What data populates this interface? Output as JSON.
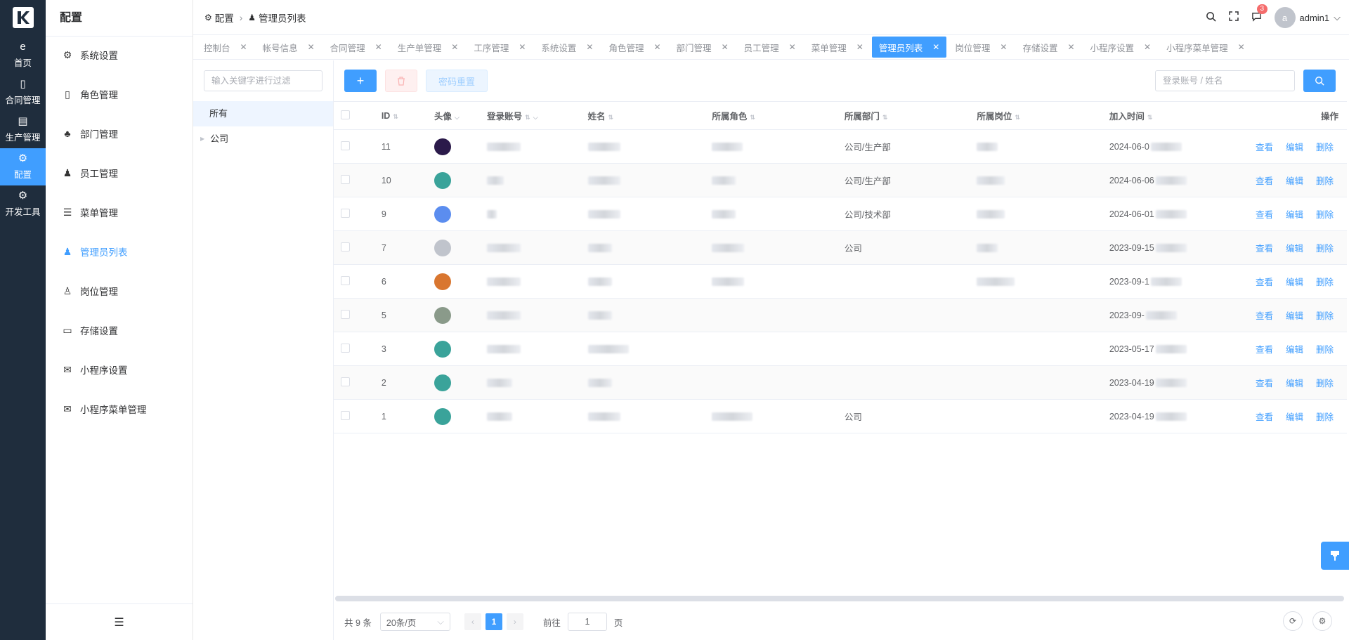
{
  "rail": {
    "items": [
      {
        "label": "首页",
        "icon": "e"
      },
      {
        "label": "合同管理",
        "icon": "▯"
      },
      {
        "label": "生产管理",
        "icon": "▤"
      },
      {
        "label": "配置",
        "icon": "⚙"
      },
      {
        "label": "开发工具",
        "icon": "⚙"
      }
    ]
  },
  "submenu": {
    "title": "配置",
    "items": [
      {
        "label": "系统设置",
        "icon": "⚙"
      },
      {
        "label": "角色管理",
        "icon": "▯"
      },
      {
        "label": "部门管理",
        "icon": "♣"
      },
      {
        "label": "员工管理",
        "icon": "♟"
      },
      {
        "label": "菜单管理",
        "icon": "☰"
      },
      {
        "label": "管理员列表",
        "icon": "♟"
      },
      {
        "label": "岗位管理",
        "icon": "♙"
      },
      {
        "label": "存储设置",
        "icon": "▭"
      },
      {
        "label": "小程序设置",
        "icon": "✉"
      },
      {
        "label": "小程序菜单管理",
        "icon": "✉"
      }
    ],
    "collapse_icon": "☰"
  },
  "header": {
    "crumb1": "配置",
    "crumb2": "管理员列表",
    "badge": "3",
    "avatar_letter": "a",
    "username": "admin1"
  },
  "tabs": [
    "控制台",
    "帐号信息",
    "合同管理",
    "生产单管理",
    "工序管理",
    "系统设置",
    "角色管理",
    "部门管理",
    "员工管理",
    "菜单管理",
    "管理员列表",
    "岗位管理",
    "存储设置",
    "小程序设置",
    "小程序菜单管理"
  ],
  "tree": {
    "placeholder": "输入关键字进行过滤",
    "all": "所有",
    "node": "公司"
  },
  "toolbar": {
    "add": "+",
    "delete": "🗑",
    "reset": "密码重置",
    "search_placeholder": "登录账号 / 姓名"
  },
  "table": {
    "headers": [
      "ID",
      "头像",
      "登录账号",
      "姓名",
      "所属角色",
      "所属部门",
      "所属岗位",
      "加入时间",
      "操作"
    ],
    "rows": [
      {
        "id": "11",
        "dept": "公司/生产部",
        "time": "2024-06-0",
        "avatar": "#2b1a4a"
      },
      {
        "id": "10",
        "dept": "公司/生产部",
        "time": "2024-06-06",
        "avatar": "#3aa39a"
      },
      {
        "id": "9",
        "dept": "公司/技术部",
        "time": "2024-06-01",
        "avatar": "#5b8def"
      },
      {
        "id": "7",
        "dept": "公司",
        "time": "2023-09-15",
        "avatar": "#c0c4cc"
      },
      {
        "id": "6",
        "dept": "",
        "time": "2023-09-1",
        "avatar": "#d9762f"
      },
      {
        "id": "5",
        "dept": "",
        "time": "2023-09-",
        "avatar": "#8a9a8a"
      },
      {
        "id": "3",
        "dept": "",
        "time": "2023-05-17",
        "avatar": "#3aa39a"
      },
      {
        "id": "2",
        "dept": "",
        "time": "2023-04-19",
        "avatar": "#3aa39a"
      },
      {
        "id": "1",
        "dept": "公司",
        "time": "2023-04-19",
        "avatar": "#3aa39a"
      }
    ],
    "ops": [
      "查看",
      "编辑",
      "删除"
    ]
  },
  "pager": {
    "total": "共 9 条",
    "page_size": "20条/页",
    "current": "1",
    "goto_label": "前往",
    "goto_value": "1",
    "page_unit": "页"
  }
}
